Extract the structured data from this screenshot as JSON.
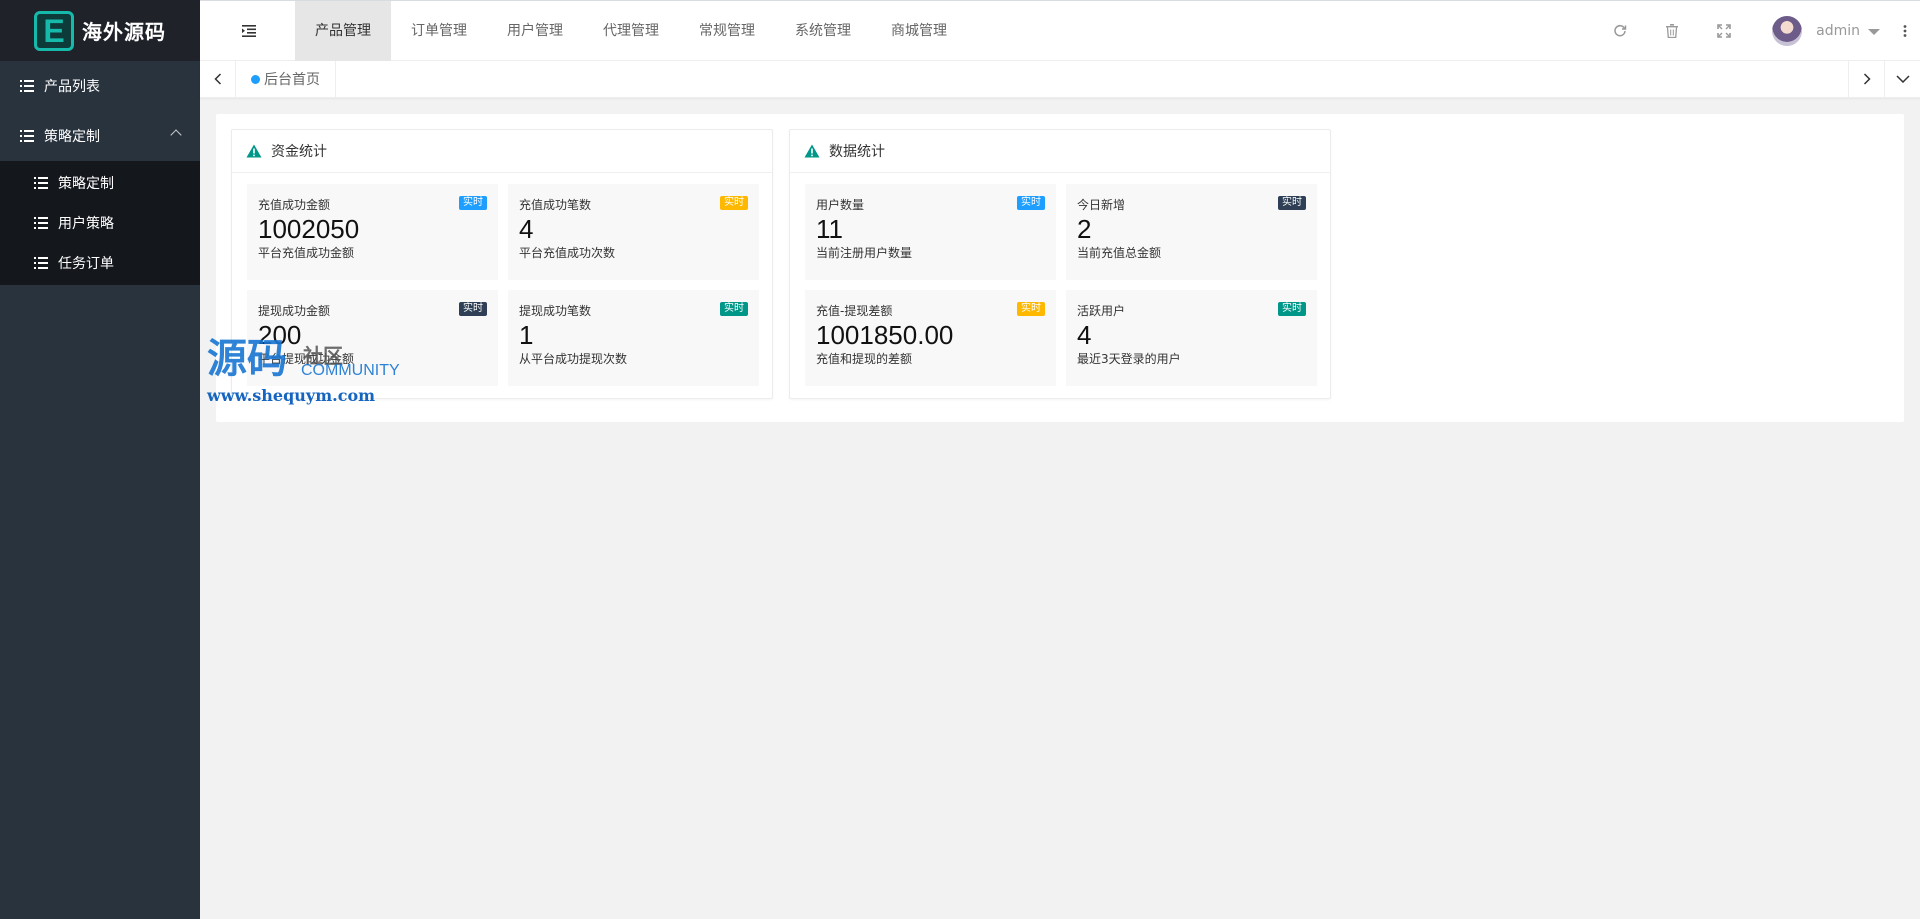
{
  "app": {
    "logo_letter": "E",
    "logo_text": "海外源码"
  },
  "sidebar": {
    "items": [
      {
        "label": "产品列表",
        "icon": "list-icon"
      },
      {
        "label": "策略定制",
        "icon": "list-icon",
        "expanded": true
      }
    ],
    "subitems": [
      {
        "label": "策略定制",
        "icon": "list-icon"
      },
      {
        "label": "用户策略",
        "icon": "list-icon"
      },
      {
        "label": "任务订单",
        "icon": "list-icon"
      }
    ]
  },
  "header": {
    "nav": [
      "产品管理",
      "订单管理",
      "用户管理",
      "代理管理",
      "常规管理",
      "系统管理",
      "商城管理"
    ],
    "active_nav": "产品管理",
    "username": "admin"
  },
  "tabs": {
    "home_label": "后台首页"
  },
  "panels": [
    {
      "title": "资金统计",
      "cards": [
        {
          "label": "充值成功金额",
          "value": "1002050",
          "desc": "平台充值成功金额",
          "badge": "实时",
          "badge_color": "#1e9fff"
        },
        {
          "label": "充值成功笔数",
          "value": "4",
          "desc": "平台充值成功次数",
          "badge": "实时",
          "badge_color": "#ffb800"
        },
        {
          "label": "提现成功金额",
          "value": "200",
          "desc": "平台提现成功金额",
          "badge": "实时",
          "badge_color": "#2f4056"
        },
        {
          "label": "提现成功笔数",
          "value": "1",
          "desc": "从平台成功提现次数",
          "badge": "实时",
          "badge_color": "#009688"
        }
      ]
    },
    {
      "title": "数据统计",
      "cards": [
        {
          "label": "用户数量",
          "value": "11",
          "desc": "当前注册用户数量",
          "badge": "实时",
          "badge_color": "#1e9fff"
        },
        {
          "label": "今日新增",
          "value": "2",
          "desc": "当前充值总金额",
          "badge": "实时",
          "badge_color": "#2f4056"
        },
        {
          "label": "充值-提现差额",
          "value": "1001850.00",
          "desc": "充值和提现的差额",
          "badge": "实时",
          "badge_color": "#ffb800"
        },
        {
          "label": "活跃用户",
          "value": "4",
          "desc": "最近3天登录的用户",
          "badge": "实时",
          "badge_color": "#009688"
        }
      ]
    }
  ],
  "watermark": {
    "big": "源码",
    "small": "社区",
    "community": "COMMUNITY",
    "url": "www.shequym.com"
  },
  "colors": {
    "sidebar_bg": "#28333e",
    "logo_bg": "#20222a",
    "submenu_bg": "#14181d",
    "accent": "#16baaa",
    "tab_dot": "#1e9fff"
  }
}
